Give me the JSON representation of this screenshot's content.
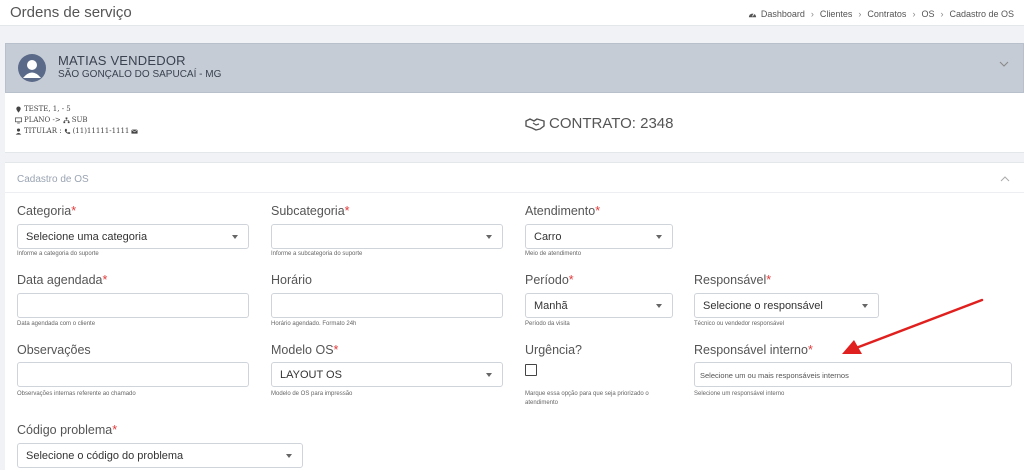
{
  "header": {
    "title": "Ordens de serviço",
    "breadcrumb": [
      "Dashboard",
      "Clientes",
      "Contratos",
      "OS",
      "Cadastro de OS"
    ],
    "separator": "›"
  },
  "client": {
    "name": "MATIAS VENDEDOR",
    "city": "SÃO GONÇALO DO SAPUCAÍ - MG"
  },
  "contract": {
    "address": "TESTE, 1, - 5",
    "plan": "PLANO ->",
    "plan_sub": "SUB",
    "holder_label": "TITULAR :",
    "holder_phone": "(11)11111-1111",
    "label": "CONTRATO: 2348"
  },
  "form": {
    "title": "Cadastro de OS",
    "required_mark": "*",
    "categoria": {
      "label": "Categoria",
      "value": "Selecione uma categoria",
      "hint": "Informe a categoria do suporte"
    },
    "subcategoria": {
      "label": "Subcategoria",
      "value": "",
      "hint": "Informe a subcategoria do suporte"
    },
    "atendimento": {
      "label": "Atendimento",
      "value": "Carro",
      "hint": "Meio de atendimento"
    },
    "data_agendada": {
      "label": "Data agendada",
      "value": "",
      "hint": "Data agendada com o cliente"
    },
    "horario": {
      "label": "Horário",
      "value": "",
      "hint": "Horário agendado. Formato 24h"
    },
    "periodo": {
      "label": "Período",
      "value": "Manhã",
      "hint": "Período da visita"
    },
    "responsavel": {
      "label": "Responsável",
      "value": "Selecione o responsável",
      "hint": "Técnico ou vendedor responsável"
    },
    "observacoes": {
      "label": "Observações",
      "value": "",
      "hint": "Observações internas referente ao chamado"
    },
    "modelo_os": {
      "label": "Modelo OS",
      "value": "LAYOUT OS",
      "hint": "Modelo de OS para impressão"
    },
    "urgencia": {
      "label": "Urgência?",
      "checked": false,
      "hint_line1": "Marque essa opção para que seja priorizado o",
      "hint_line2": "atendimento"
    },
    "responsavel_interno": {
      "label": "Responsável interno",
      "placeholder": "Selecione um ou mais responsáveis internos",
      "hint": "Selecione um responsável interno"
    },
    "codigo_problema": {
      "label": "Código problema",
      "value": "Selecione o código do problema"
    }
  },
  "colors": {
    "required": "#e03b3b",
    "client_bar": "#c5ccd6",
    "annotation_arrow": "#e0201e"
  }
}
